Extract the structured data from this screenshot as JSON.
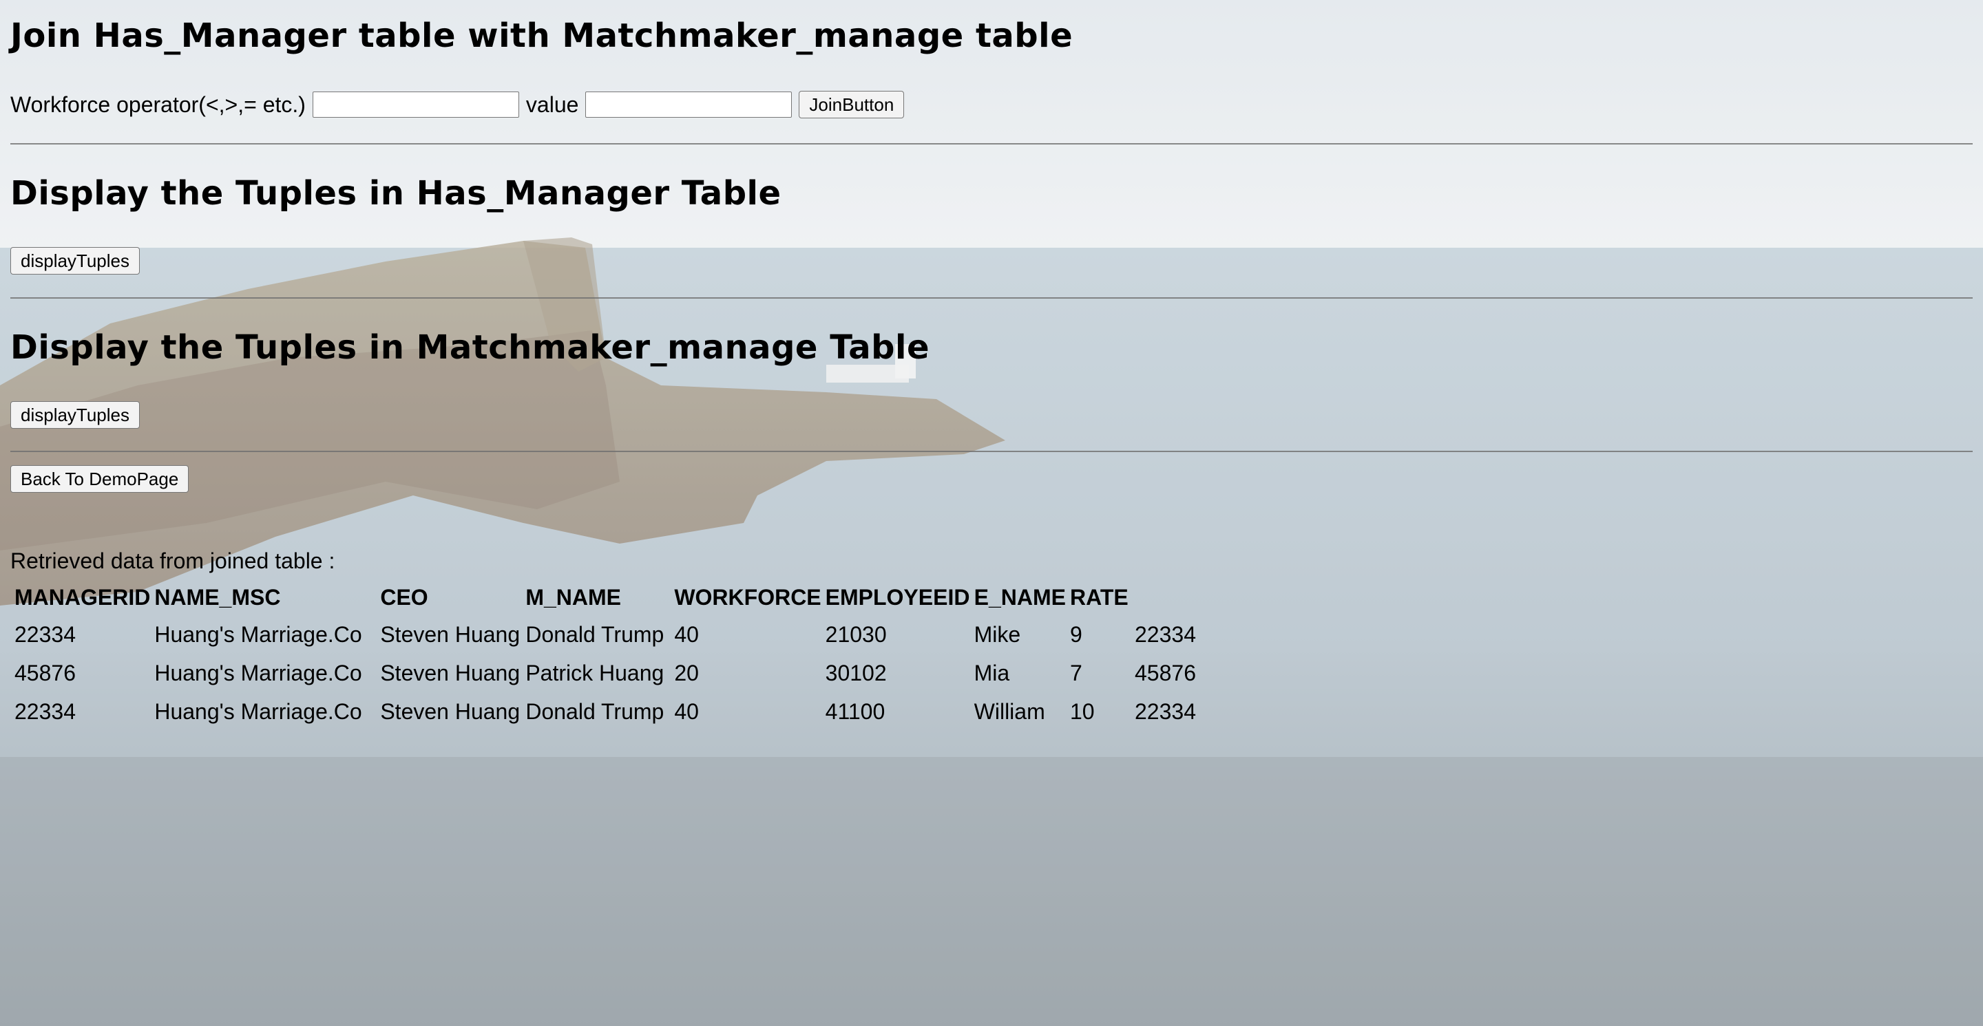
{
  "join_section": {
    "title": "Join Has_Manager table with Matchmaker_manage table",
    "operator_label": "Workforce operator(<,>,= etc.)",
    "operator_value": "",
    "value_label": "value",
    "value_value": "",
    "join_button": "JoinButton"
  },
  "has_manager_section": {
    "title": "Display the Tuples in Has_Manager Table",
    "button": "displayTuples"
  },
  "matchmaker_section": {
    "title": "Display the Tuples in Matchmaker_manage Table",
    "button": "displayTuples"
  },
  "back_button": "Back To DemoPage",
  "results": {
    "caption": "Retrieved data from joined table :",
    "headers": [
      "MANAGERID",
      "NAME_MSC",
      "CEO",
      "M_NAME",
      "WORKFORCE",
      "EMPLOYEEID",
      "E_NAME",
      "RATE"
    ],
    "rows": [
      [
        "22334",
        "Huang's Marriage.Co",
        "Steven Huang",
        "Donald Trump",
        "40",
        "21030",
        "Mike",
        "9",
        "22334"
      ],
      [
        "45876",
        "Huang's Marriage.Co",
        "Steven Huang",
        "Patrick Huang",
        "20",
        "30102",
        "Mia",
        "7",
        "45876"
      ],
      [
        "22334",
        "Huang's Marriage.Co",
        "Steven Huang",
        "Donald Trump",
        "40",
        "41100",
        "William",
        "10",
        "22334"
      ]
    ]
  }
}
